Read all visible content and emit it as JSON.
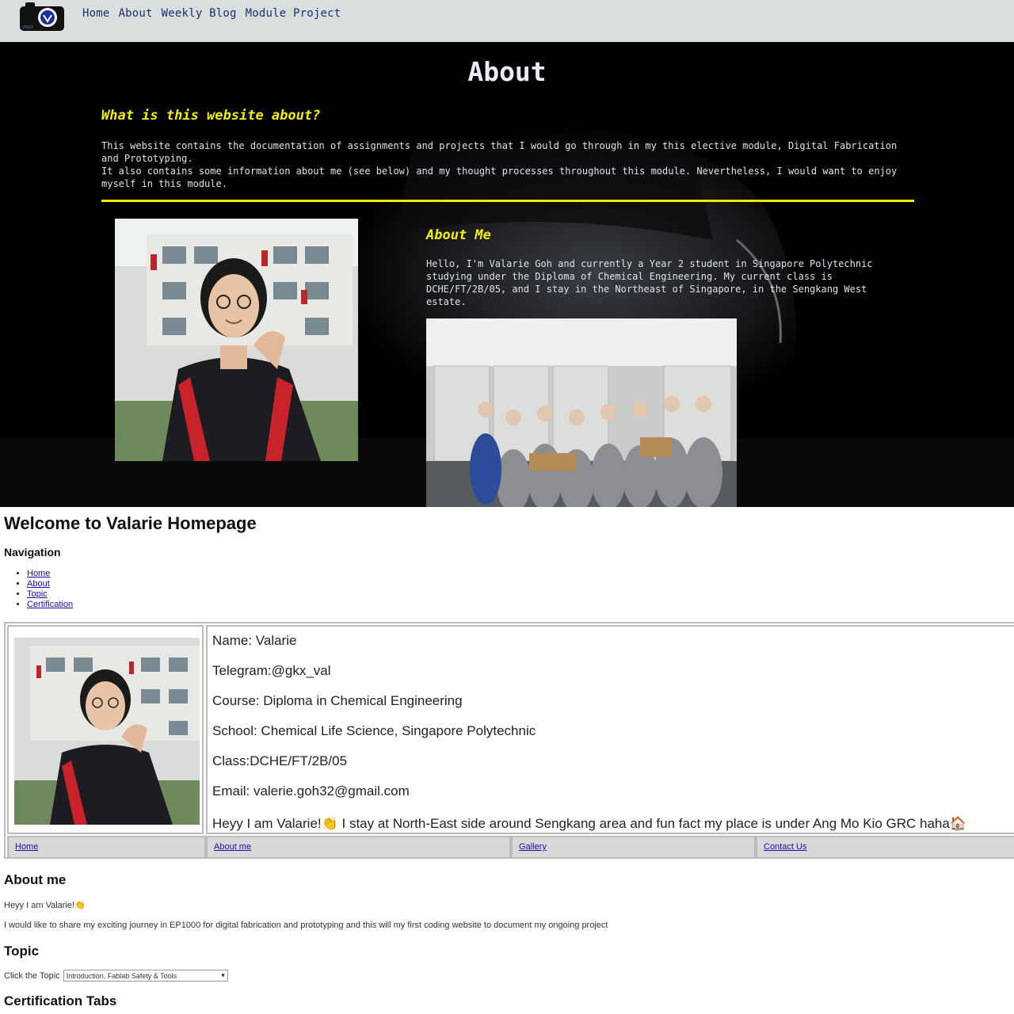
{
  "site": {
    "logo_text": "VGKX",
    "nav": [
      "Home",
      "About",
      "Weekly Blog",
      "Module Project"
    ]
  },
  "hero": {
    "title": "About",
    "question_heading": "What is this website about?",
    "intro_line1": "This website contains the documentation of assignments and projects that I would go through in my this elective module, Digital Fabrication and Prototyping.",
    "intro_line2": "It also contains some information about me (see below) and my thought processes throughout this module. Nevertheless, I would want to enjoy myself in this module.",
    "about_me_heading": "About Me",
    "about_me_text": "Hello, I'm Valarie Goh and currently a Year 2 student in Singapore Polytechnic studying under the Diploma of Chemical Engineering. My current class is DCHE/FT/2B/05, and I stay in the Northeast of Singapore, in the Sengkang West estate."
  },
  "plain": {
    "welcome": "Welcome to Valarie Homepage",
    "navigation_heading": "Navigation",
    "nav_items": [
      "Home",
      "About",
      "Topic",
      "Certification"
    ],
    "info": {
      "name": "Name: Valarie",
      "telegram": "Telegram:@gkx_val",
      "course": "Course: Diploma in Chemical Engineering",
      "school": "School: Chemical Life Science, Singapore Polytechnic",
      "class": "Class:DCHE/FT/2B/05",
      "email": "Email: valerie.goh32@gmail.com",
      "bio": "Heyy I am Valarie!👏 I stay at North-East side around Sengkang area and fun fact my place is under Ang Mo Kio GRC haha🏠"
    },
    "link_row": [
      "Home",
      "About me",
      "Gallery",
      "Contact Us"
    ],
    "about_heading": "About me",
    "about_line1": "Heyy I am Valarie!👏",
    "about_line2": "I would like to share my exciting journey in EP1000 for digital fabrication and prototyping and this will my first coding website to document my ongoing project",
    "topic_heading": "Topic",
    "topic_label": "Click the Topic",
    "topic_selected": "Introduction, Fablab Safety & Tools",
    "cert_heading": "Certification Tabs"
  },
  "colors": {
    "nav_bg": "#d9dfdf",
    "nav_link": "#1d2f6b",
    "heading_yellow": "#f4f200",
    "hero_bg": "#000000",
    "link_blue": "#1a0dab"
  }
}
